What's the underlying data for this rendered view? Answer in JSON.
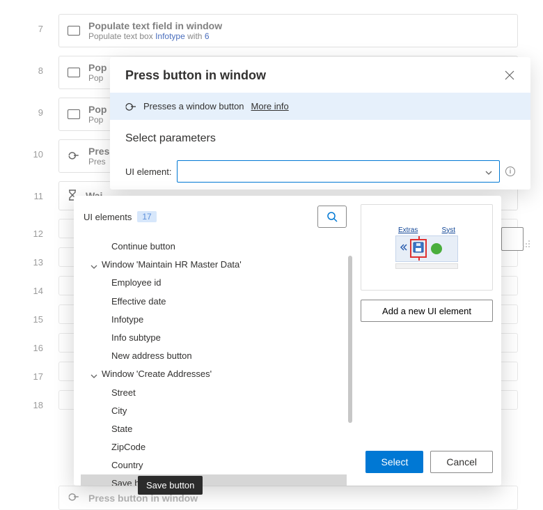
{
  "steps": [
    {
      "num": "7",
      "title": "Populate text field in window",
      "sub": [
        "Populate text box",
        "Infotype",
        "with",
        "6"
      ],
      "icon": "textbox"
    },
    {
      "num": "8",
      "title": "Pop",
      "sub": [
        "Pop"
      ],
      "icon": "textbox"
    },
    {
      "num": "9",
      "title": "Pop",
      "sub": [
        "Pop"
      ],
      "icon": "textbox"
    },
    {
      "num": "10",
      "title": "Pres",
      "sub": [
        "Pres"
      ],
      "icon": "press"
    },
    {
      "num": "11",
      "title": "Wai",
      "sub": [],
      "icon": "wait"
    },
    {
      "num": "12"
    },
    {
      "num": "13"
    },
    {
      "num": "14"
    },
    {
      "num": "15"
    },
    {
      "num": "16"
    },
    {
      "num": "17"
    },
    {
      "num": "18"
    }
  ],
  "last_step_title": "Press button in window",
  "modal": {
    "title": "Press button in window",
    "info": "Presses a window button",
    "more_info": "More info",
    "select_parameters": "Select parameters",
    "ui_element_label": "UI element:"
  },
  "dropdown": {
    "header": "UI elements",
    "count": "17",
    "tree": {
      "rowA": "Continue button",
      "group1": "Window 'Maintain HR Master Data'",
      "g1_i1": "Employee id",
      "g1_i2": "Effective date",
      "g1_i3": "Infotype",
      "g1_i4": "Info subtype",
      "g1_i5": "New address button",
      "group2": "Window 'Create Addresses'",
      "g2_i1": "Street",
      "g2_i2": "City",
      "g2_i3": "State",
      "g2_i4": "ZipCode",
      "g2_i5": "Country",
      "g2_i6": "Save button"
    },
    "preview": {
      "t1": "Extras",
      "t2": "Syst"
    },
    "add_new": "Add a new UI element",
    "select": "Select",
    "cancel": "Cancel"
  },
  "tooltip": "Save button"
}
